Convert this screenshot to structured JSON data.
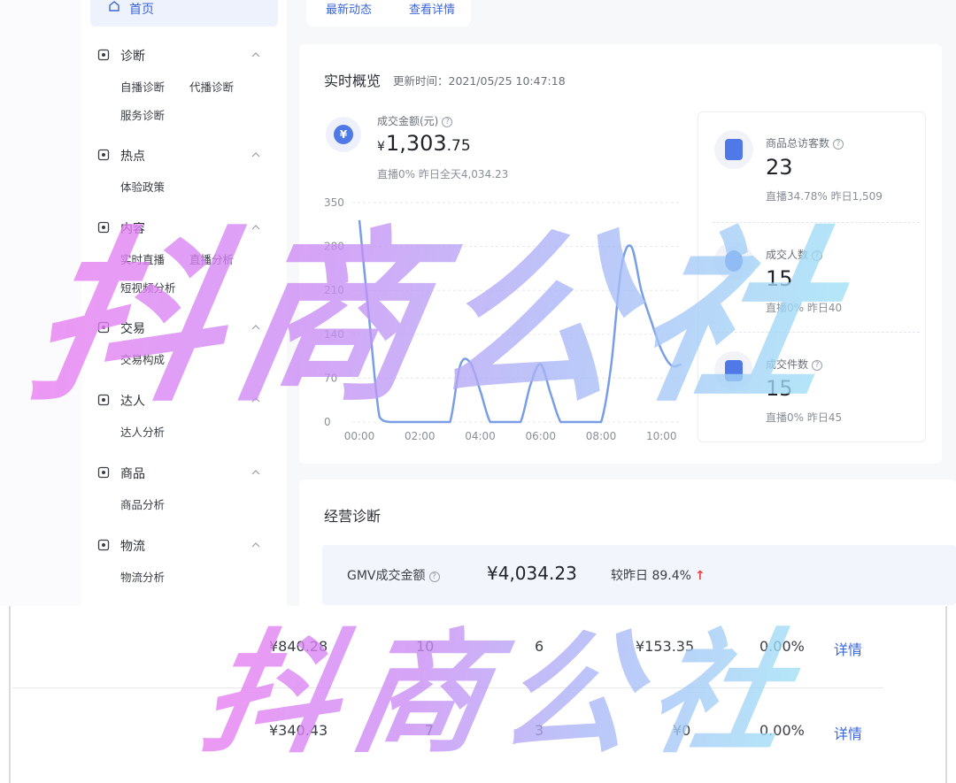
{
  "sidebar": {
    "home": "首页",
    "groups": [
      {
        "title": "诊断",
        "items": [
          "自播诊断",
          "代播诊断",
          "服务诊断"
        ]
      },
      {
        "title": "热点",
        "items": [
          "体验政策"
        ]
      },
      {
        "title": "内容",
        "items": [
          "实时直播",
          "直播分析",
          "短视频分析"
        ]
      },
      {
        "title": "交易",
        "items": [
          "交易构成"
        ]
      },
      {
        "title": "达人",
        "items": [
          "达人分析"
        ]
      },
      {
        "title": "商品",
        "items": [
          "商品分析"
        ]
      },
      {
        "title": "物流",
        "items": [
          "物流分析"
        ]
      }
    ]
  },
  "top_tabs": [
    "最新动态",
    "查看详情"
  ],
  "realtime": {
    "title": "实时概览",
    "update_label": "更新时间：2021/05/25 10:47:18",
    "gmv": {
      "label": "成交金额(元)",
      "currency": "¥",
      "int_part": "1,303",
      "dec_part": ".75",
      "note": "直播0%   昨日全天4,034.23"
    },
    "stats": [
      {
        "label": "商品总访客数",
        "value": "23",
        "note": "直播34.78%   昨日1,509"
      },
      {
        "label": "成交人数",
        "value": "15",
        "note": "直播0%   昨日40"
      },
      {
        "label": "成交件数",
        "value": "15",
        "note": "直播0%   昨日45"
      }
    ]
  },
  "business": {
    "title": "经营诊断",
    "gmv_label": "GMV成交金额",
    "gmv_value": "¥4,034.23",
    "compare": "较昨日 89.4%",
    "arrow": "↑"
  },
  "table_rows": [
    {
      "c1": "¥840.28",
      "c2": "10",
      "c3": "6",
      "c4": "¥153.35",
      "c5": "0.00%",
      "link": "详情"
    },
    {
      "c1": "¥340.43",
      "c2": "7",
      "c3": "3",
      "c4": "¥0",
      "c5": "0.00%",
      "link": "详情"
    }
  ],
  "watermark": "抖商公社",
  "colors": {
    "accent": "#3c66d9",
    "line": "#7a9ee6",
    "up": "#e54545"
  },
  "chart_data": {
    "type": "line",
    "x": [
      "00:00",
      "00:20",
      "00:40",
      "01:00",
      "01:20",
      "01:40",
      "02:00",
      "02:20",
      "02:40",
      "03:00",
      "03:20",
      "03:40",
      "04:00",
      "04:20",
      "04:40",
      "05:00",
      "05:20",
      "05:40",
      "06:00",
      "06:20",
      "06:40",
      "07:00",
      "07:20",
      "07:40",
      "08:00",
      "08:20",
      "08:40",
      "09:00",
      "09:20",
      "09:40",
      "10:00",
      "10:20",
      "10:40"
    ],
    "values": [
      322,
      160,
      8,
      0,
      0,
      0,
      0,
      0,
      0,
      0,
      90,
      95,
      50,
      0,
      0,
      0,
      0,
      60,
      92,
      45,
      0,
      0,
      0,
      0,
      0,
      90,
      245,
      280,
      210,
      160,
      115,
      90,
      92
    ],
    "x_ticks": [
      "00:00",
      "02:00",
      "04:00",
      "06:00",
      "08:00",
      "10:00"
    ],
    "y_ticks": [
      0,
      70,
      140,
      210,
      280,
      350
    ],
    "ylim": [
      0,
      350
    ],
    "grid": true
  }
}
